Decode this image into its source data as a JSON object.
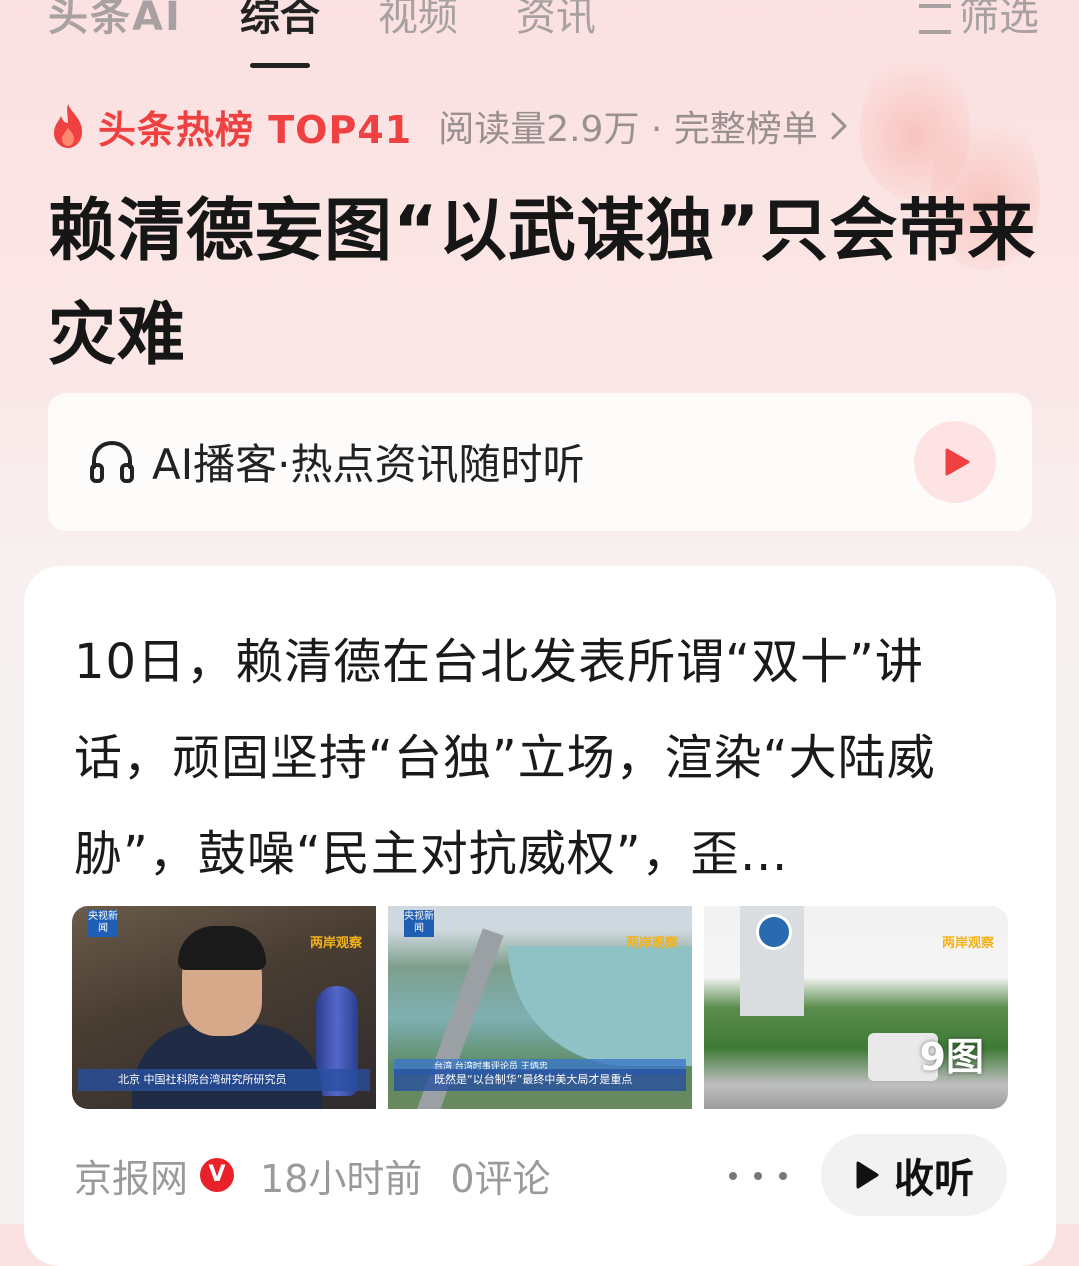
{
  "tabs": [
    {
      "label": "头条AI"
    },
    {
      "label": "综合",
      "active": true
    },
    {
      "label": "视频"
    },
    {
      "label": "资讯"
    },
    {
      "label": "筛选",
      "icon": "filter-icon"
    }
  ],
  "hot": {
    "title": "头条热榜 TOP41",
    "meta": "阅读量2.9万 · 完整榜单",
    "icon": "fire-icon"
  },
  "headline": "赖清德妄图“以武谋独”只会带来灾难",
  "podcast": {
    "label": "AI播客·热点资讯随时听",
    "icon": "headphones-icon"
  },
  "article": {
    "summary": "10日，赖清德在台北发表所谓“双十”讲话，顽固坚持“台独”立场，渲染“大陆威胁”，鼓噪“民主对抗威权”，歪…",
    "images": [
      {
        "badge": "央视新闻",
        "program": "两岸观察",
        "caption": "北京 中国社科院台湾研究所研究员"
      },
      {
        "badge": "央视新闻",
        "program": "两岸观察",
        "caption_top": "台湾 台湾时事评论员 王炳忠",
        "caption": "既然是“以台制华”最终中美大局才是重点"
      },
      {
        "program": "两岸观察",
        "count": "9图"
      }
    ],
    "source": "京报网",
    "verified": "V",
    "time": "18小时前",
    "comments": "0评论",
    "listen_label": "收听"
  }
}
